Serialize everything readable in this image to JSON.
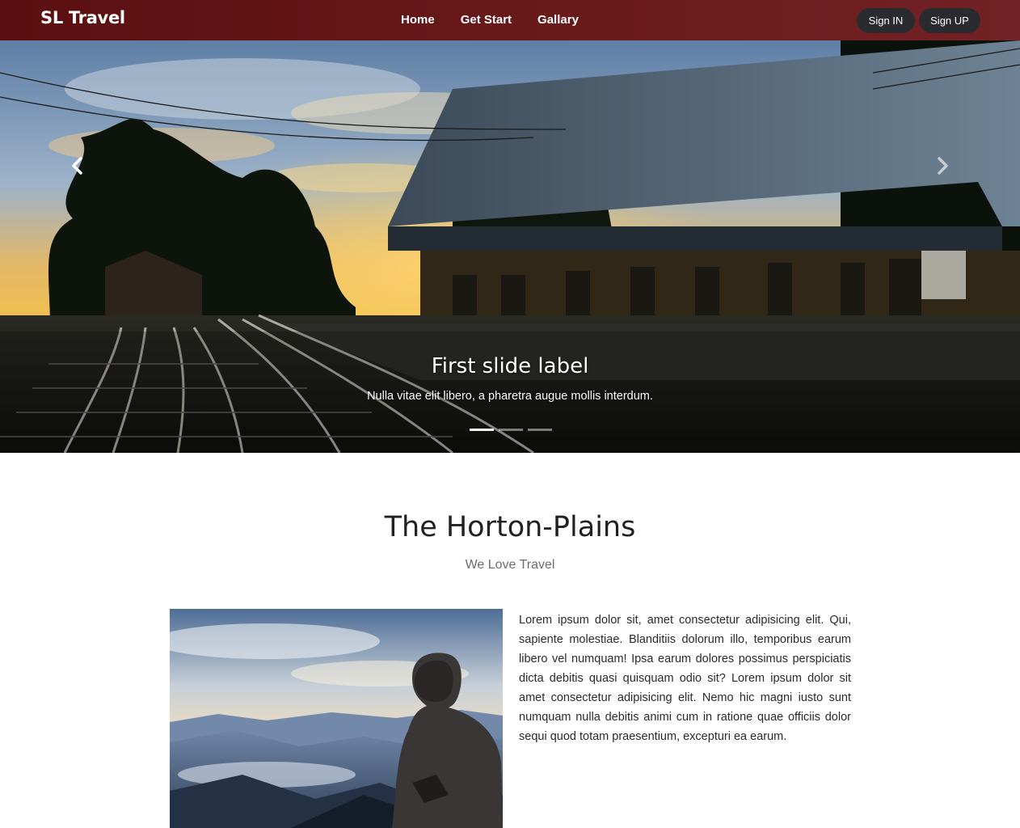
{
  "navbar": {
    "brand": "SL Travel",
    "links": [
      "Home",
      "Get Start",
      "Gallary"
    ],
    "signin_label": "Sign IN",
    "signup_label": "Sign UP",
    "background_color": "#6b1a1b"
  },
  "carousel": {
    "slide_caption_title": "First slide label",
    "slide_caption_text": "Nulla vitae elit libero, a pharetra augue mollis interdum.",
    "indicator_count": 3,
    "active_indicator": 0,
    "prev_icon": "chevron-left-icon",
    "next_icon": "chevron-right-icon"
  },
  "section": {
    "title": "The Horton-Plains",
    "subtitle": "We Love Travel",
    "body": "Lorem ipsum dolor sit, amet consectetur adipisicing elit. Qui, sapiente molestiae. Blanditiis dolorum illo, temporibus earum libero vel numquam! Ipsa earum dolores possimus perspiciatis dicta debitis quasi quisquam odio sit? Lorem ipsum dolor sit amet consectetur adipisicing elit. Nemo hic magni iusto sunt numquam nulla debitis animi cum in ratione quae officiis dolor sequi quod totam praesentium, excepturi ea earum."
  }
}
